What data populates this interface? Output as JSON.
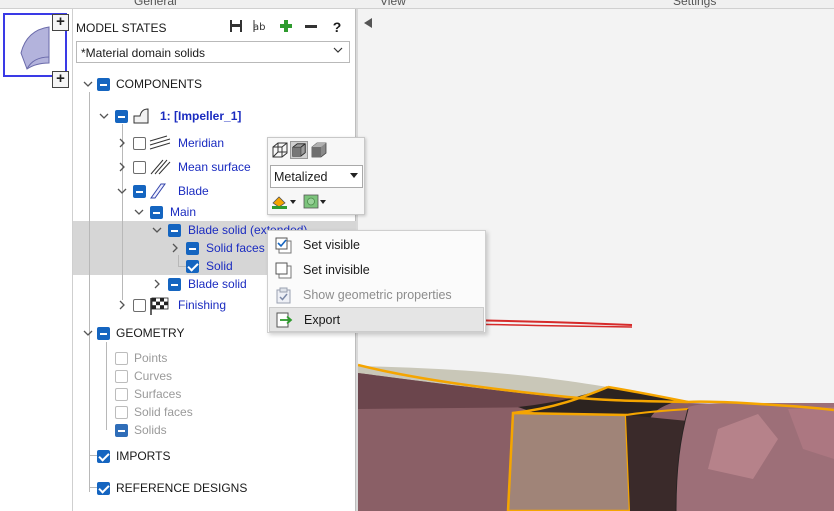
{
  "menu": {
    "left": "General",
    "middle": "View",
    "right": "Settings"
  },
  "thumbnail": {
    "add_top": "+",
    "add_bottom": "+"
  },
  "panel": {
    "title": "MODEL STATES",
    "help": "?",
    "dropdown_value": "*Material domain solids",
    "tree": {
      "components": "COMPONENTS",
      "impeller": "1: [Impeller_1]",
      "meridian": "Meridian",
      "mean_surface": "Mean surface",
      "blade": "Blade",
      "main": "Main",
      "blade_solid_ext": "Blade solid (extended)",
      "solid_faces": "Solid faces",
      "solid": "Solid",
      "blade_solid": "Blade solid",
      "finishing": "Finishing",
      "geometry": "GEOMETRY",
      "points": "Points",
      "curves": "Curves",
      "surfaces": "Surfaces",
      "geo_solid_faces": "Solid faces",
      "solids": "Solids",
      "imports": "IMPORTS",
      "reference_designs": "REFERENCE DESIGNS"
    }
  },
  "format_toolbar": {
    "render_mode": "Metalized"
  },
  "context_menu": {
    "set_visible": "Set visible",
    "set_invisible": "Set invisible",
    "show_geo_props": "Show geometric properties",
    "export": "Export"
  },
  "colors": {
    "accent_blue": "#1565c0",
    "label_blue": "#1a2bc0",
    "annotation_red": "#d62a2a",
    "edge_orange": "#f5a500",
    "surface_mauve": "#8a5f66"
  }
}
